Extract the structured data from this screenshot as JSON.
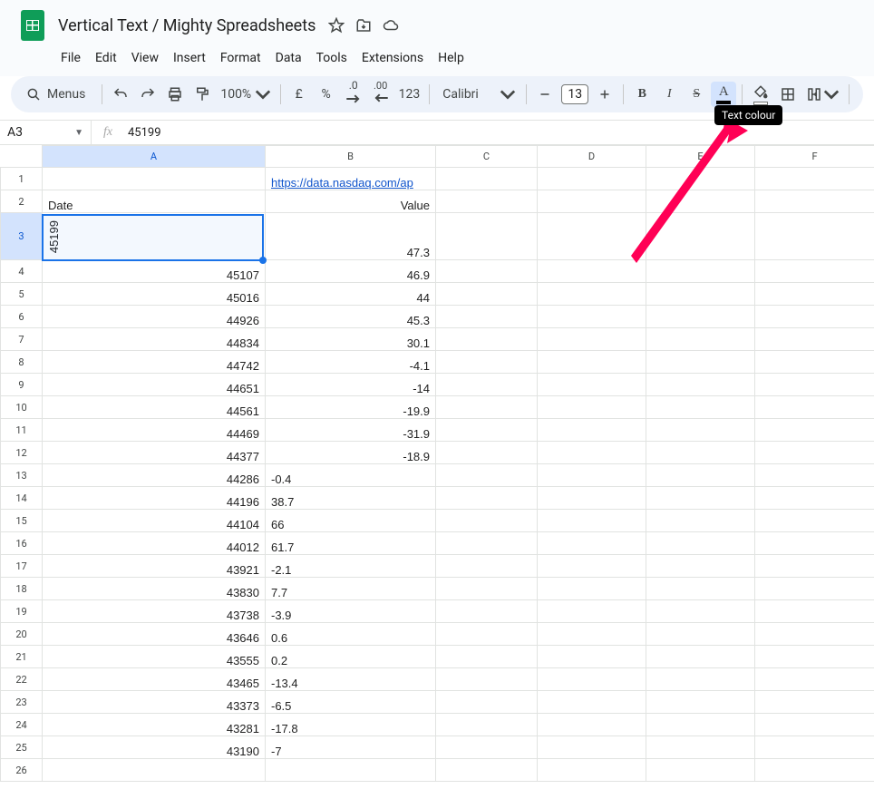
{
  "header": {
    "doc_title": "Vertical Text / Mighty Spreadsheets",
    "menus": [
      "File",
      "Edit",
      "View",
      "Insert",
      "Format",
      "Data",
      "Tools",
      "Extensions",
      "Help"
    ]
  },
  "toolbar": {
    "search_label": "Menus",
    "zoom": "100%",
    "currency": "£",
    "percent": "%",
    "dec_dec": ".0",
    "inc_dec": ".00",
    "num_format": "123",
    "font_name": "Calibri",
    "font_size": "13",
    "tooltip": "Text colour"
  },
  "namebox": "A3",
  "formula_value": "45199",
  "columns": [
    "A",
    "B",
    "C",
    "D",
    "E",
    "F"
  ],
  "rows": [
    {
      "n": 1,
      "A": "",
      "B": "https://data.nasdaq.com/ap",
      "B_link": true,
      "B_align": "left"
    },
    {
      "n": 2,
      "A": "Date",
      "A_align": "left",
      "B": "Value",
      "B_align": "right"
    },
    {
      "n": 3,
      "A": "45199",
      "A_vertical": true,
      "A_align": "left",
      "B": "47.3",
      "B_align": "right",
      "tall": true,
      "selected": true
    },
    {
      "n": 4,
      "A": "45107",
      "A_align": "right",
      "B": "46.9",
      "B_align": "right"
    },
    {
      "n": 5,
      "A": "45016",
      "A_align": "right",
      "B": "44",
      "B_align": "right"
    },
    {
      "n": 6,
      "A": "44926",
      "A_align": "right",
      "B": "45.3",
      "B_align": "right"
    },
    {
      "n": 7,
      "A": "44834",
      "A_align": "right",
      "B": "30.1",
      "B_align": "right"
    },
    {
      "n": 8,
      "A": "44742",
      "A_align": "right",
      "B": "-4.1",
      "B_align": "right"
    },
    {
      "n": 9,
      "A": "44651",
      "A_align": "right",
      "B": "-14",
      "B_align": "right"
    },
    {
      "n": 10,
      "A": "44561",
      "A_align": "right",
      "B": "-19.9",
      "B_align": "right"
    },
    {
      "n": 11,
      "A": "44469",
      "A_align": "right",
      "B": "-31.9",
      "B_align": "right"
    },
    {
      "n": 12,
      "A": "44377",
      "A_align": "right",
      "B": "-18.9",
      "B_align": "right"
    },
    {
      "n": 13,
      "A": "44286",
      "A_align": "right",
      "B": "-0.4",
      "B_align": "left",
      "B_overflow": true
    },
    {
      "n": 14,
      "A": "44196",
      "A_align": "right",
      "B": "38.7",
      "B_align": "left",
      "B_overflow": true
    },
    {
      "n": 15,
      "A": "44104",
      "A_align": "right",
      "B": "66",
      "B_align": "left",
      "B_overflow": true
    },
    {
      "n": 16,
      "A": "44012",
      "A_align": "right",
      "B": "61.7",
      "B_align": "left",
      "B_overflow": true
    },
    {
      "n": 17,
      "A": "43921",
      "A_align": "right",
      "B": "-2.1",
      "B_align": "left",
      "B_overflow": true
    },
    {
      "n": 18,
      "A": "43830",
      "A_align": "right",
      "B": "7.7",
      "B_align": "left",
      "B_overflow": true
    },
    {
      "n": 19,
      "A": "43738",
      "A_align": "right",
      "B": "-3.9",
      "B_align": "left",
      "B_overflow": true
    },
    {
      "n": 20,
      "A": "43646",
      "A_align": "right",
      "B": "0.6",
      "B_align": "left",
      "B_overflow": true
    },
    {
      "n": 21,
      "A": "43555",
      "A_align": "right",
      "B": "0.2",
      "B_align": "left",
      "B_overflow": true
    },
    {
      "n": 22,
      "A": "43465",
      "A_align": "right",
      "B": "-13.4",
      "B_align": "left",
      "B_overflow": true
    },
    {
      "n": 23,
      "A": "43373",
      "A_align": "right",
      "B": "-6.5",
      "B_align": "left",
      "B_overflow": true
    },
    {
      "n": 24,
      "A": "43281",
      "A_align": "right",
      "B": "-17.8",
      "B_align": "left",
      "B_overflow": true
    },
    {
      "n": 25,
      "A": "43190",
      "A_align": "right",
      "B": "-7",
      "B_align": "left",
      "B_overflow": true
    },
    {
      "n": 26,
      "A": "",
      "B": ""
    }
  ]
}
